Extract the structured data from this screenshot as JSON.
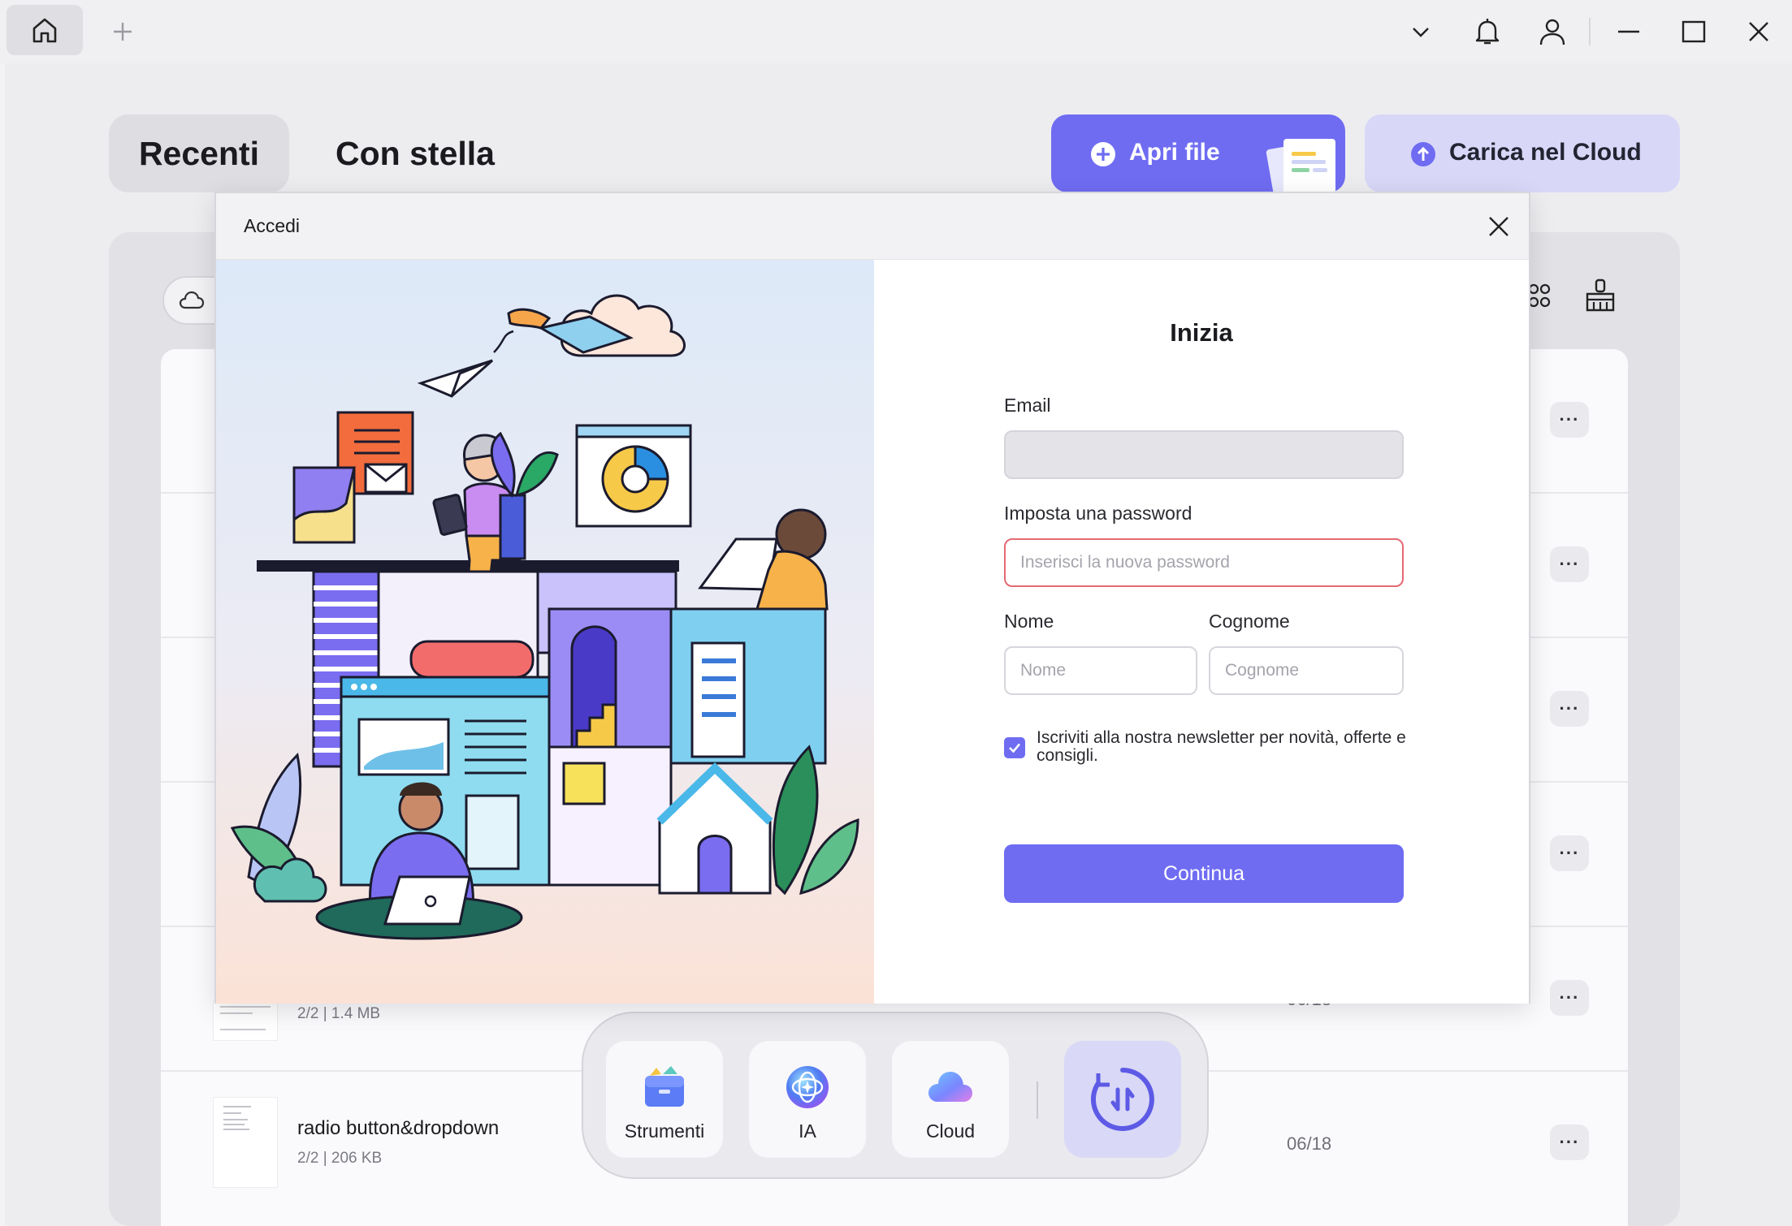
{
  "titlebar": {
    "icons": [
      "home-icon",
      "plus-icon",
      "chevron-down-icon",
      "bell-icon",
      "user-icon",
      "minimize-icon",
      "maximize-icon",
      "close-icon"
    ]
  },
  "tabs": [
    {
      "label": "Recenti",
      "active": true
    },
    {
      "label": "Con stella",
      "active": false
    }
  ],
  "actions": {
    "open_file": "Apri file",
    "upload_cloud": "Carica nel Cloud"
  },
  "files": [
    {
      "title": "",
      "meta": "2/2 | 1.4 MB",
      "date": "06/18"
    },
    {
      "title": "radio button&dropdown",
      "meta": "2/2 | 206 KB",
      "date": "06/18"
    }
  ],
  "dock": {
    "items": [
      {
        "label": "Strumenti",
        "icon": "toolbox-icon"
      },
      {
        "label": "IA",
        "icon": "ai-icon"
      },
      {
        "label": "Cloud",
        "icon": "cloud-icon"
      }
    ],
    "convert_icon": "convert-icon"
  },
  "modal": {
    "title": "Accedi",
    "heading": "Inizia",
    "email_label": "Email",
    "email_value": "",
    "password_label": "Imposta una password",
    "password_placeholder": "Inserisci la nuova password",
    "first_name_label": "Nome",
    "first_name_placeholder": "Nome",
    "last_name_label": "Cognome",
    "last_name_placeholder": "Cognome",
    "newsletter_checked": true,
    "newsletter_text": "Iscriviti alla nostra newsletter per novità, offerte e consigli.",
    "continue_label": "Continua"
  },
  "colors": {
    "accent": "#6f6cf2",
    "accent_light": "#d8d7f7",
    "error_border": "#e46a72"
  }
}
